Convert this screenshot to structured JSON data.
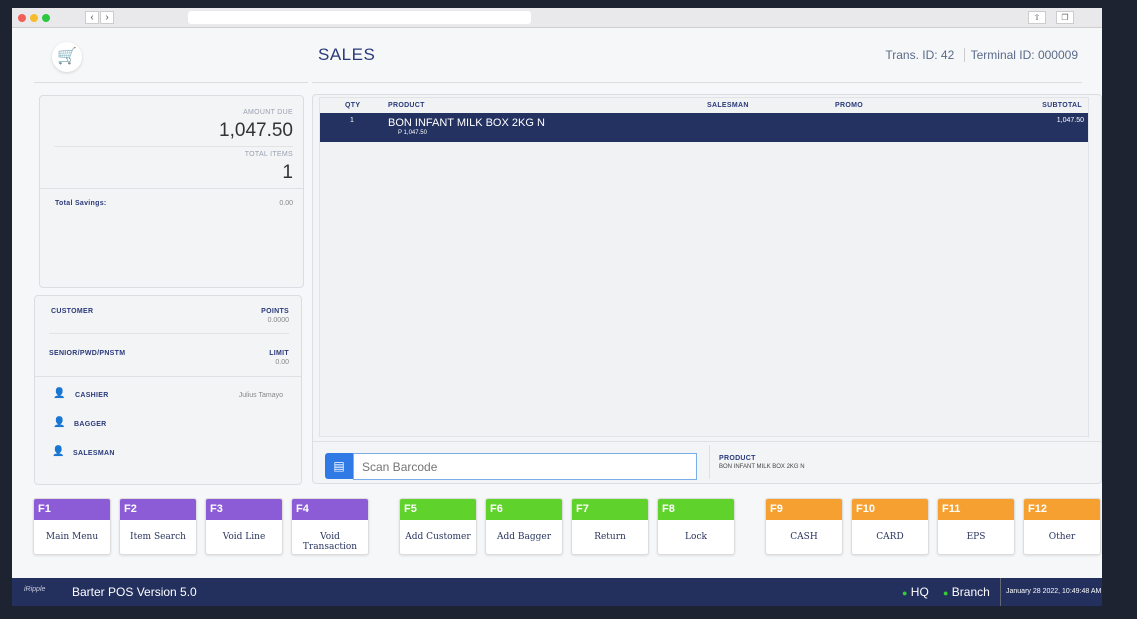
{
  "header": {
    "title": "SALES",
    "trans_id": "Trans. ID: 42",
    "terminal_id": "Terminal ID: 000009"
  },
  "summary": {
    "amount_due_label": "AMOUNT DUE",
    "amount_due": "1,047.50",
    "total_items_label": "TOTAL ITEMS",
    "total_items": "1",
    "savings_label": "Total Savings:",
    "savings": "0.00"
  },
  "customer": {
    "customer_label": "CUSTOMER",
    "points_label": "POINTS",
    "points": "0.0000",
    "senior_label": "SENIOR/PWD/PNSTM",
    "limit_label": "LIMIT",
    "limit": "0.00",
    "cashier_label": "CASHIER",
    "cashier": "Julius Tamayo",
    "bagger_label": "BAGGER",
    "salesman_label": "SALESMAN"
  },
  "table": {
    "columns": [
      "QTY",
      "PRODUCT",
      "SALESMAN",
      "PROMO",
      "SUBTOTAL"
    ],
    "rows": [
      {
        "qty": "1",
        "product": "BON INFANT MILK BOX 2KG N",
        "price": "P 1,047.50",
        "salesman": "",
        "promo": "",
        "subtotal": "1,047.50"
      }
    ]
  },
  "scan": {
    "placeholder": "Scan Barcode",
    "product_label": "PRODUCT",
    "product": "BON INFANT MILK BOX 2KG N"
  },
  "fkeys": [
    {
      "key": "F1",
      "label": "Main Menu",
      "color": "#8b5cd6"
    },
    {
      "key": "F2",
      "label": "Item Search",
      "color": "#8b5cd6"
    },
    {
      "key": "F3",
      "label": "Void Line",
      "color": "#8b5cd6"
    },
    {
      "key": "F4",
      "label": "Void Transaction",
      "color": "#8b5cd6"
    },
    {
      "key": "F5",
      "label": "Add Customer",
      "color": "#5fd32b"
    },
    {
      "key": "F6",
      "label": "Add Bagger",
      "color": "#5fd32b"
    },
    {
      "key": "F7",
      "label": "Return",
      "color": "#5fd32b"
    },
    {
      "key": "F8",
      "label": "Lock",
      "color": "#5fd32b"
    },
    {
      "key": "F9",
      "label": "CASH",
      "color": "#f7a032"
    },
    {
      "key": "F10",
      "label": "CARD",
      "color": "#f7a032"
    },
    {
      "key": "F11",
      "label": "EPS",
      "color": "#f7a032"
    },
    {
      "key": "F12",
      "label": "Other",
      "color": "#f7a032"
    }
  ],
  "status": {
    "logo": "iRipple",
    "version": "Barter POS Version 5.0",
    "hq": "HQ",
    "branch": "Branch",
    "datetime": "January 28 2022, 10:49:48 AM"
  }
}
